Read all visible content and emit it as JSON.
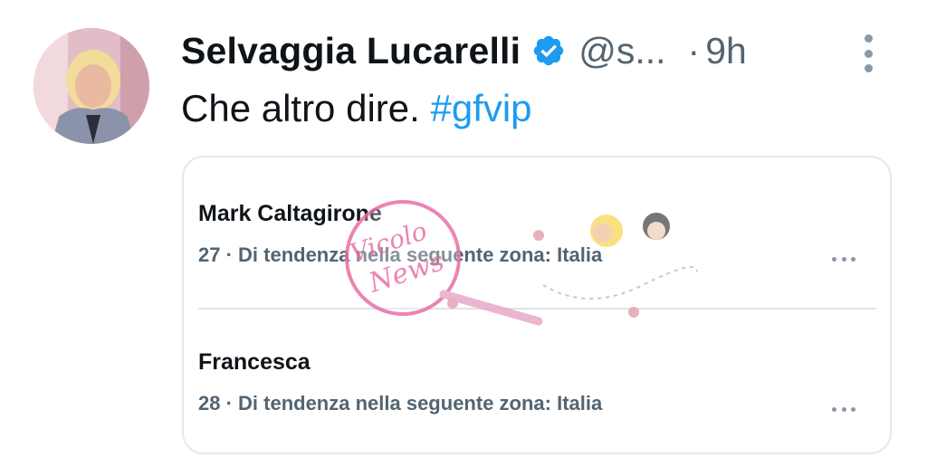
{
  "tweet": {
    "author_name": "Selvaggia Lucarelli",
    "handle": "@s...",
    "separator": "·",
    "time": "9h",
    "text": "Che altro dire.",
    "hashtag": "#gfvip",
    "verified_icon": "verified-badge-icon",
    "more_icon": "vertical-ellipsis-icon"
  },
  "trends": [
    {
      "name": "Mark Caltagirone",
      "meta": "27 · Di tendenza nella seguente zona: Italia"
    },
    {
      "name": "Francesca",
      "meta": "28 · Di tendenza nella seguente zona: Italia"
    }
  ],
  "watermark": {
    "text": "Vicolo News"
  },
  "colors": {
    "link": "#1d9bf0",
    "secondary": "#536471",
    "text": "#0f1419",
    "border": "#e6e8ea",
    "watermark": "#e86fa6"
  }
}
